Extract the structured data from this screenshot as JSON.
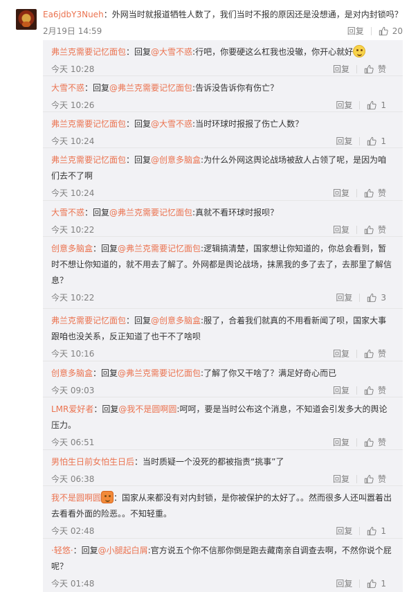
{
  "top_comment": {
    "user": "Ea6jdbY3Nueh",
    "sep": "：",
    "text": "外网当时就报道牺牲人数了，我们当时不报的原因还是没想通，是对内封锁吗？",
    "time": "2月19日 14:59",
    "reply_label": "回复",
    "like_count": "20"
  },
  "replies": [
    {
      "user": "弗兰克需要记忆面包",
      "pre": "：回复",
      "at": "@大雪不惑",
      "text": ":行吧，你要硬这么杠我也没辙，你开心就好",
      "emoji": "smile",
      "time": "今天 10:28",
      "reply_label": "回复",
      "like_count": "赞"
    },
    {
      "user": "大雪不惑",
      "pre": "：回复",
      "at": "@弗兰克需要记忆面包",
      "text": ":告诉没告诉你有伤亡？",
      "time": "今天 10:26",
      "reply_label": "回复",
      "like_count": "1"
    },
    {
      "user": "弗兰克需要记忆面包",
      "pre": "：回复",
      "at": "@大雪不惑",
      "text": ":当时环球时报报了伤亡人数？",
      "time": "今天 10:24",
      "reply_label": "回复",
      "like_count": "1"
    },
    {
      "user": "弗兰克需要记忆面包",
      "pre": "：回复",
      "at": "@创意多脑盒",
      "text": ":为什么外网这舆论战场被敌人占领了呢，是因为咱们去不了啊",
      "time": "今天 10:24",
      "reply_label": "回复",
      "like_count": "赞"
    },
    {
      "user": "大雪不惑",
      "pre": "：回复",
      "at": "@弗兰克需要记忆面包",
      "text": ":真就不看环球时报呗？",
      "time": "今天 10:22",
      "reply_label": "回复",
      "like_count": "赞"
    },
    {
      "user": "创意多脑盒",
      "pre": "：回复",
      "at": "@弗兰克需要记忆面包",
      "text": ":逻辑搞清楚，国家想让你知道的，你总会看到，暂时不想让你知道的，就不用去了解了。外网都是舆论战场，抹黑我的多了去了，去那里了解信息？",
      "time": "今天 10:22",
      "reply_label": "回复",
      "like_count": "3"
    },
    {
      "user": "弗兰克需要记忆面包",
      "pre": "：回复",
      "at": "@创意多脑盒",
      "text": ":服了，合着我们就真的不用看新闻了呗，国家大事跟咱也没关系，反正知道了也干不了啥呗",
      "time": "今天 10:16",
      "reply_label": "回复",
      "like_count": "赞"
    },
    {
      "user": "创意多脑盒",
      "pre": "：回复",
      "at": "@弗兰克需要记忆面包",
      "text": ":了解了你又干啥了？满足好奇心而已",
      "time": "今天 09:03",
      "reply_label": "回复",
      "like_count": "赞"
    },
    {
      "user": "LMR爱好者",
      "pre": "：回复",
      "at": "@我不是圆啊圆",
      "text": ":呵呵，要是当时公布这个消息，不知道会引发多大的舆论压力。",
      "time": "今天 06:51",
      "reply_label": "回复",
      "like_count": "赞"
    },
    {
      "user": "男怕生日前女怕生日后",
      "pre": "",
      "at": "",
      "text": "：当时质疑一个没死的都被指责“挑事”了",
      "time": "今天 06:38",
      "reply_label": "回复",
      "like_count": "赞"
    },
    {
      "user": "我不是圆啊圆",
      "pre": "",
      "at": "",
      "emoji_after_user": "angry",
      "text": "：国家从来都没有对内封锁，是你被保护的太好了。。然而很多人还叫嚣着出去看看外面的险恶。。不知轻重。",
      "time": "今天 02:48",
      "reply_label": "回复",
      "like_count": "1"
    },
    {
      "user": "·轻悠·",
      "pre": "：回复",
      "at": "@小腿起白屑",
      "text": ":官方说五个你不信那你倒是跑去藏南亲自调查去啊，不然你说个屁呢？",
      "time": "今天 01:48",
      "reply_label": "回复",
      "like_count": "1"
    }
  ],
  "icons": {
    "like": "thumbs-up-icon"
  },
  "colors": {
    "username": "#eb7350",
    "text": "#333333",
    "meta": "#808080",
    "panel": "#f2f2f5"
  }
}
